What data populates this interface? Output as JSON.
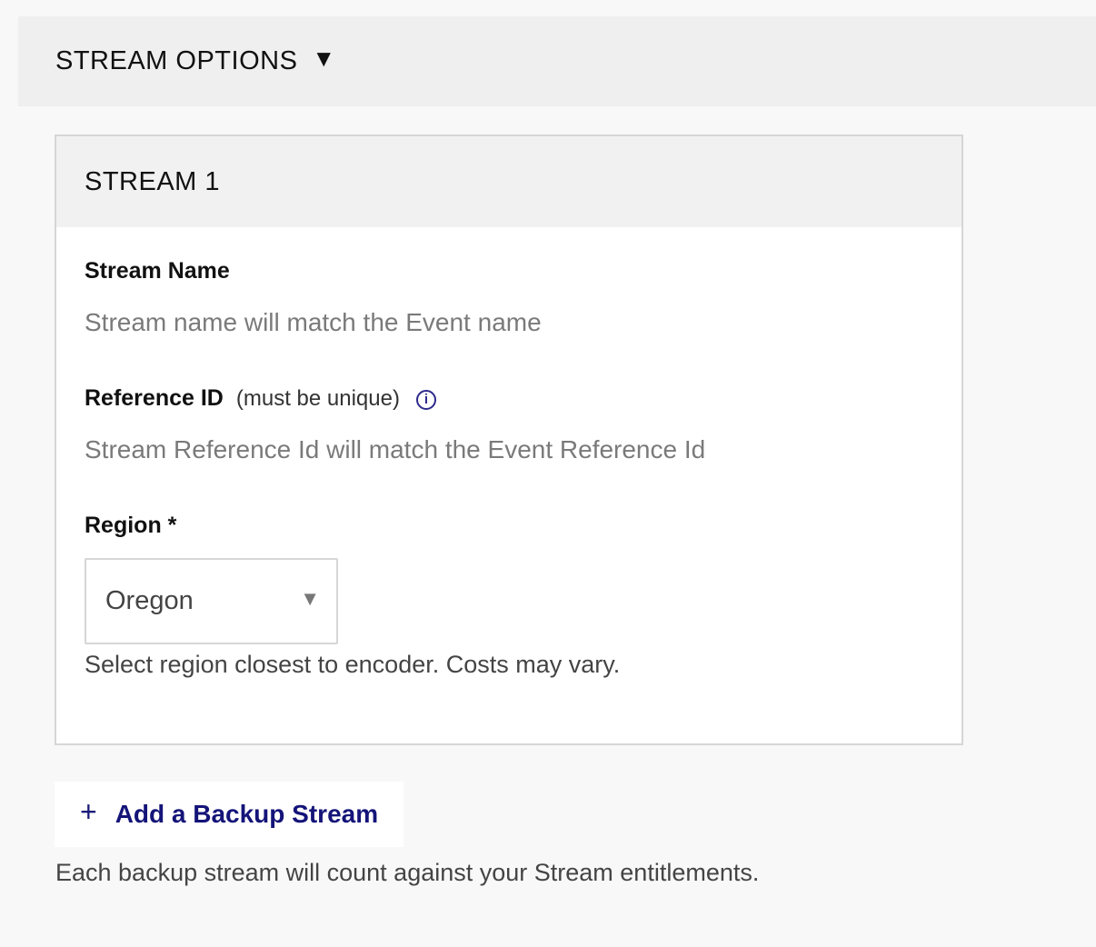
{
  "section": {
    "title": "STREAM OPTIONS",
    "caret_icon": "triangle-down-icon"
  },
  "stream": {
    "title": "STREAM 1",
    "name_label": "Stream Name",
    "name_value": "Stream name will match the Event name",
    "ref_label": "Reference ID",
    "ref_sub": "(must be unique)",
    "ref_info_icon": "info-icon",
    "ref_value": "Stream Reference Id will match the Event Reference Id",
    "region_label": "Region *",
    "region_value": "Oregon",
    "region_help": "Select region closest to encoder. Costs may vary."
  },
  "backup": {
    "plus": "+",
    "label": "Add a Backup Stream",
    "note": "Each backup stream will count against your Stream entitlements."
  },
  "colors": {
    "accent": "#141479",
    "info": "#2d2a8c",
    "placeholder": "#7a7a7a"
  }
}
